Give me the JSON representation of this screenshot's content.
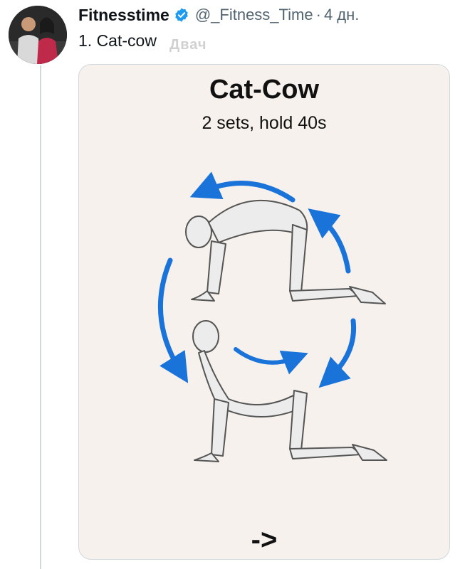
{
  "post": {
    "display_name": "Fitnesstime",
    "handle": "@_Fitness_Time",
    "separator": "·",
    "time": "4 дн.",
    "text": "1. Cat-cow",
    "watermark": "Двач"
  },
  "media": {
    "title": "Cat-Cow",
    "subtitle": "2 sets, hold 40s",
    "next": "->"
  },
  "colors": {
    "verified": "#1d9bf0",
    "arrow_blue": "#1a73d9",
    "card_bg": "#f6f1ec"
  },
  "icons": {
    "verified": "verified-badge-icon"
  }
}
